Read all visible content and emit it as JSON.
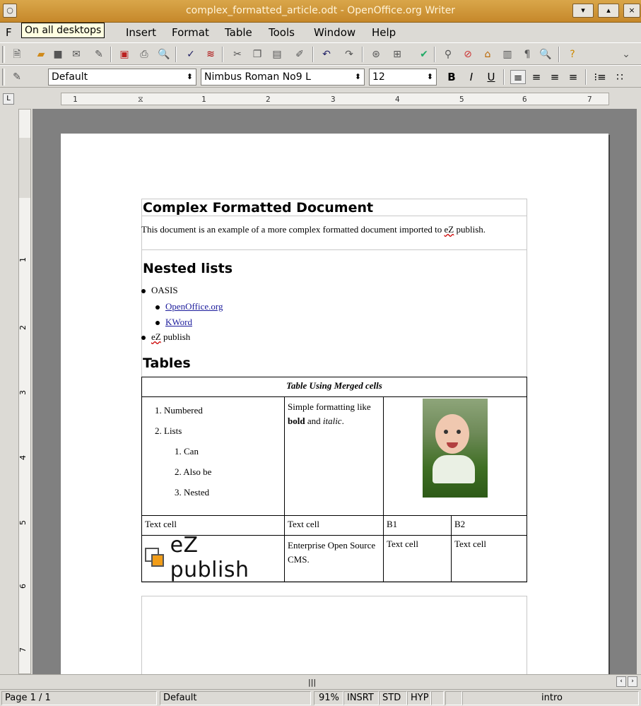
{
  "window": {
    "title": "complex_formatted_article.odt - OpenOffice.org Writer",
    "tooltip": "On all desktops"
  },
  "menu": [
    "Insert",
    "Format",
    "Table",
    "Tools",
    "Window",
    "Help"
  ],
  "formatting": {
    "style": "Default",
    "font": "Nimbus Roman No9 L",
    "size": "12",
    "bold": "B",
    "italic": "I",
    "underline": "U"
  },
  "ruler": [
    "1",
    "1",
    "2",
    "3",
    "4",
    "5",
    "6",
    "7"
  ],
  "vruler": [
    "1",
    "2",
    "3",
    "4",
    "5",
    "6",
    "7"
  ],
  "document": {
    "title": "Complex Formatted Document",
    "intro_before": "This document is an example of a more complex formatted document imported to ",
    "intro_ez": "eZ",
    "intro_after": " publish.",
    "nested_heading": "Nested lists",
    "list": {
      "oasis": "OASIS",
      "openoffice": "OpenOffice.org",
      "kword": "KWord",
      "ez": "eZ",
      "ez_after": " publish"
    },
    "tables_heading": "Tables",
    "table": {
      "caption": "Table Using Merged cells",
      "numbered": [
        "1.",
        "Numbered",
        "2.",
        "Lists"
      ],
      "nested": [
        "1.",
        "Can",
        "2.",
        "Also be",
        "3.",
        "Nested"
      ],
      "simple_prefix": "Simple formatting like ",
      "simple_bold": "bold",
      "simple_and": " and ",
      "simple_italic": "italic",
      "simple_end": ".",
      "row2": [
        "Text cell",
        "Text cell",
        "B1",
        "B2"
      ],
      "logo_text": "eZ publish",
      "enterprise": "Enterprise Open Source CMS.",
      "row3_c3": "Text cell",
      "row3_c4": "Text cell"
    }
  },
  "statusbar": {
    "page": "Page 1 / 1",
    "style": "Default",
    "zoom": "91%",
    "insert": "INSRT",
    "std": "STD",
    "hyp": "HYP",
    "section": "intro"
  }
}
